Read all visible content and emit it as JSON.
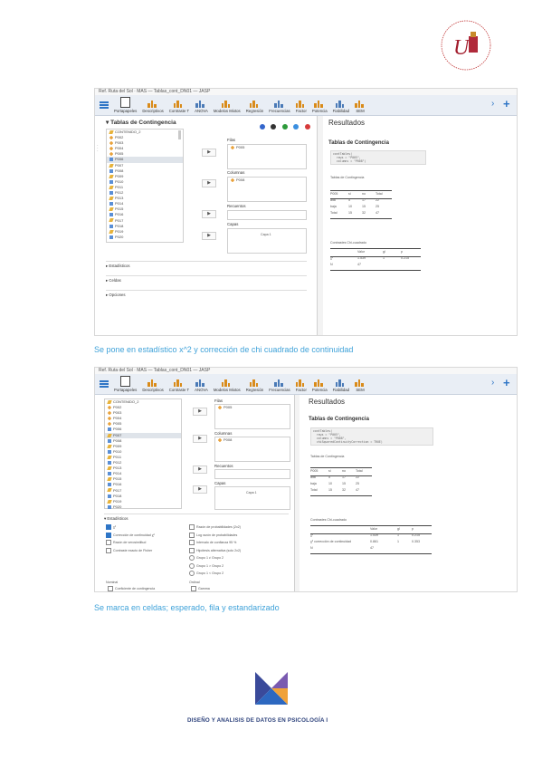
{
  "logo": {
    "alt_text": "Universidad de Sevilla"
  },
  "shot1": {
    "titlebar": "Ref. Ruta del Sol · MAS — Tablas_cont_DN01 — JASP",
    "toolbar": [
      {
        "label": "Portapapeles",
        "icon": "doc-icon"
      },
      {
        "label": "Descriptivos",
        "icon": "bar-icon"
      },
      {
        "label": "Contraste T",
        "icon": "ttest-icon"
      },
      {
        "label": "ANOVA",
        "icon": "anova-icon"
      },
      {
        "label": "Modelos Mixtos",
        "icon": "mixed-icon"
      },
      {
        "label": "Regresión",
        "icon": "regression-icon"
      },
      {
        "label": "Frecuencias",
        "icon": "freq-icon"
      },
      {
        "label": "Factor",
        "icon": "factor-icon"
      },
      {
        "label": "Potencia",
        "icon": "power-icon"
      },
      {
        "label": "Fiabilidad",
        "icon": "reliability-icon"
      },
      {
        "label": "SEM",
        "icon": "sem-icon"
      }
    ],
    "panel_title": "Tablas de Contingencia",
    "variables": [
      "CONTENIDO_2",
      "P002",
      "P003",
      "P004",
      "P005",
      "P006",
      "P007",
      "P008",
      "P009",
      "P010",
      "P011",
      "P012",
      "P013",
      "P014",
      "P015",
      "P016",
      "P017",
      "P018",
      "P019",
      "P020"
    ],
    "filas_label": "Filas",
    "filas_value": "P005",
    "columnas_label": "Columnas",
    "columnas_value": "P008",
    "recuentos_label": "Recuentos",
    "capas_label": "Capas",
    "capas_value": "Capa 1",
    "sections": [
      "Estadísticos",
      "Celdas",
      "Opciones"
    ],
    "results_title": "Resultados",
    "results_sub": "Tablas de Contingencia",
    "code": "contTables(\n  rows = \"P005\",\n  columns = \"P008\")",
    "table1_caption": "Tablas de Contingencia",
    "table1_header": [
      "P005",
      "P008"
    ],
    "table1_rows": [
      [
        "P005",
        "si",
        "no",
        "Total"
      ],
      [
        "alta",
        "5",
        "17",
        "22"
      ],
      [
        "baja",
        "10",
        "15",
        "25"
      ],
      [
        "Total",
        "15",
        "32",
        "47"
      ]
    ],
    "table2_caption": "Contrastes Chi-cuadrado",
    "table2_rows": [
      [
        "",
        "Valor",
        "gl",
        "p"
      ],
      [
        "χ²",
        "1.539",
        "1",
        "0.215"
      ],
      [
        "N",
        "47",
        "",
        ""
      ]
    ]
  },
  "caption1": "Se pone en estadístico x^2 y corrección de chi cuadrado de continuidad",
  "shot2": {
    "titlebar": "Ref. Ruta del Sol · MAS — Tablas_cont_DN01 — JASP",
    "variables": [
      "CONTENIDO_2",
      "P002",
      "P003",
      "P004",
      "P005",
      "P006",
      "P007",
      "P008",
      "P009",
      "P010",
      "P011",
      "P012",
      "P013",
      "P014",
      "P015",
      "P016",
      "P017",
      "P018",
      "P019",
      "P020"
    ],
    "filas_label": "Filas",
    "filas_value": "P005",
    "columnas_label": "Columnas",
    "columnas_value": "P008",
    "recuentos_label": "Recuentos",
    "capas_label": "Capas",
    "capas_value": "Capa 1",
    "stats_section": "Estadísticos",
    "options_left": [
      {
        "label": "χ²",
        "checked": true
      },
      {
        "label": "Corrección de continuidad χ²",
        "checked": true
      },
      {
        "label": "Razón de verosimilitud",
        "checked": false
      },
      {
        "label": "Contraste exacto de Fisher",
        "checked": false
      }
    ],
    "options_right": [
      {
        "label": "Razón de probabilidades (2x2)",
        "checked": false
      },
      {
        "label": "Log razón de probabilidades",
        "checked": false
      },
      {
        "label": "Intervalo de confianza 95 %",
        "checked": false
      },
      {
        "label": "Hipótesis alternativa (solo 2x2)",
        "checked": false
      },
      {
        "label": "Grupo 1 ≠ Grupo 2",
        "checked": false
      },
      {
        "label": "Grupo 1 > Grupo 2",
        "checked": false
      },
      {
        "label": "Grupo 1 < Grupo 2",
        "checked": false
      }
    ],
    "bottom_left_label": "Nominal",
    "bottom_left_item": "Coeficiente de contingencia",
    "bottom_right_label": "Ordinal",
    "bottom_right_item": "Gamma",
    "results_title": "Resultados",
    "results_sub": "Tablas de Contingencia",
    "code": "contTables(\n  rows = \"P005\",\n  columns = \"P008\",\n  chiSquaredContinuityCorrection = TRUE)",
    "table1_caption": "Tablas de Contingencia",
    "table1_rows": [
      [
        "P005",
        "si",
        "no",
        "Total"
      ],
      [
        "alta",
        "5",
        "17",
        "22"
      ],
      [
        "baja",
        "10",
        "15",
        "25"
      ],
      [
        "Total",
        "15",
        "32",
        "47"
      ]
    ],
    "table2_caption": "Contrastes Chi-cuadrado",
    "table2_rows": [
      [
        "",
        "Valor",
        "gl",
        "p"
      ],
      [
        "χ²",
        "1.539",
        "1",
        "0.215"
      ],
      [
        "χ² corrección de continuidad",
        "0.861",
        "1",
        "0.353"
      ],
      [
        "N",
        "47",
        "",
        ""
      ]
    ]
  },
  "caption2": "Se marca en celdas; esperado, fila y estandarizado",
  "footer": {
    "title": "DISEÑO Y ANALISIS DE DATOS EN PSICOLOGÍA I"
  }
}
